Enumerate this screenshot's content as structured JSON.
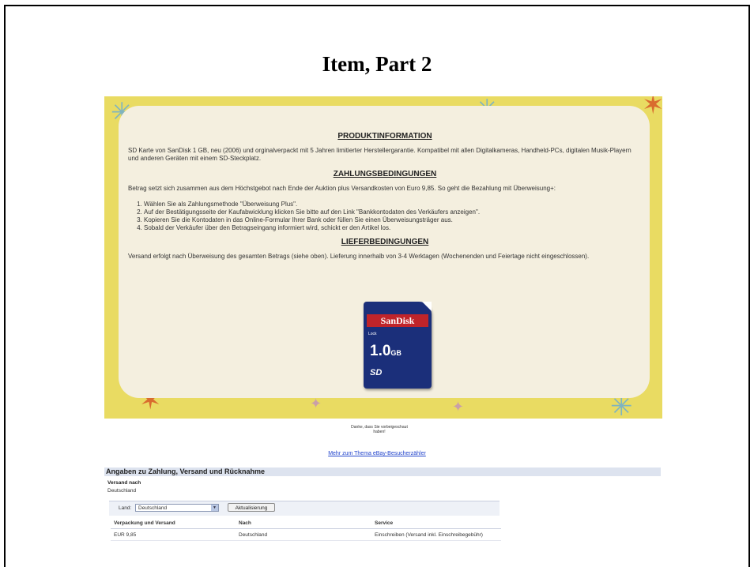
{
  "slide": {
    "title": "Item, Part 2"
  },
  "listing": {
    "produktinfo_heading": "PRODUKTINFORMATION",
    "produktinfo_text": "SD Karte von SanDisk 1 GB, neu (2006) und orginalverpackt mit 5 Jahren limitierter Herstellergarantie. Kompatibel mit allen Digitalkameras, Handheld-PCs, digitalen Musik-Playern und  anderen Geräten mit einem SD-Steckplatz.",
    "zahlung_heading": "ZAHLUNGSBEDINGUNGEN",
    "zahlung_text": "Betrag setzt sich zusammen aus dem Höchstgebot nach Ende der Auktion plus Versandkosten von Euro 9,85. So geht die Bezahlung mit Überweisung+:",
    "zahlung_steps": [
      "Wählen Sie als Zahlungsmethode \"Überweisung Plus\".",
      "Auf der Bestätigungsseite der Kaufabwicklung klicken Sie bitte auf den Link \"Bankkontodaten des Verkäufers anzeigen\".",
      "Kopieren Sie die Kontodaten in das Online-Formular Ihrer Bank oder füllen Sie einen Überweisungsträger aus.",
      "Sobald der Verkäufer über den Betragseingang informiert wird, schickt er den Artikel los."
    ],
    "liefer_heading": "LIEFERBEDINGUNGEN",
    "liefer_text": "Versand erfolgt nach Überweisung des gesamten Betrags (siehe oben). Lieferung innerhalb von 3-4 Werktagen (Wochenenden und Feiertage nicht eingeschlossen).",
    "sdcard": {
      "brand": "SanDisk",
      "lock": "Lock",
      "capacity": "1.0",
      "unit": "GB",
      "logo": "SD"
    }
  },
  "counter": {
    "thanks": "Danke, dass Sie vorbeigeschaut haben!",
    "link": "Mehr zum Thema eBay-Besucherzähler"
  },
  "payment": {
    "header": "Angaben zu Zahlung, Versand und Rücknahme",
    "ship_to_label": "Versand nach",
    "ship_to_value": "Deutschland",
    "land_label": "Land:",
    "land_value": "Deutschland",
    "update_button": "Aktualisierung",
    "columns": [
      "Verpackung und Versand",
      "Nach",
      "Service"
    ],
    "rows": [
      [
        "EUR 9,85",
        "Deutschland",
        "Einschreiben (Versand inkl. Einschreibegebühr)"
      ]
    ]
  },
  "colors": {
    "banner": "#e9db62",
    "card": "#f4efdf",
    "header_bg": "#dde3ef",
    "link": "#2244cc"
  }
}
